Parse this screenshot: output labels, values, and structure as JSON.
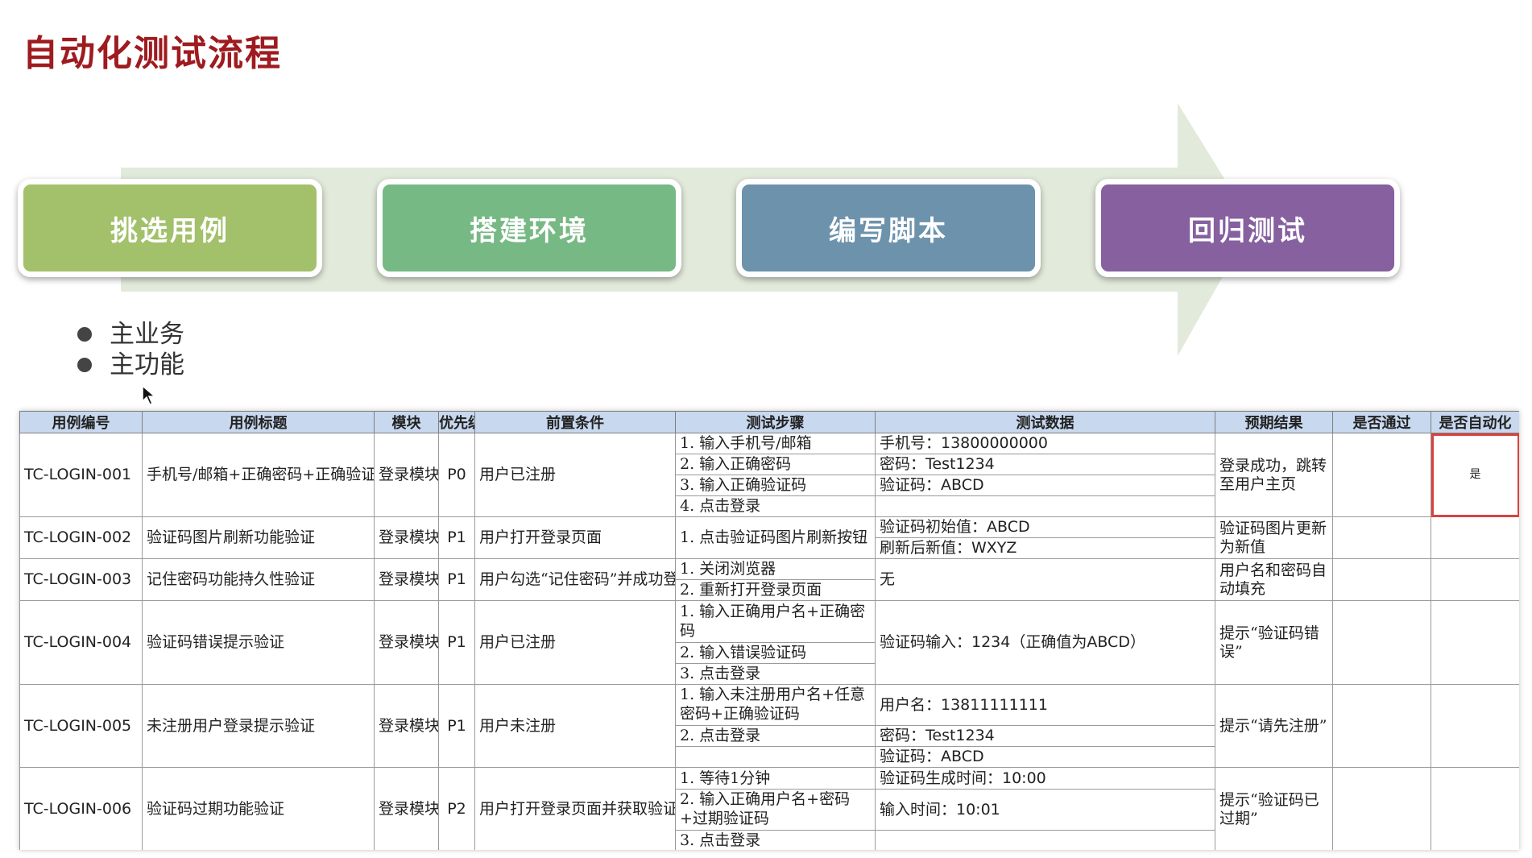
{
  "page": {
    "title": "自动化测试流程"
  },
  "flow": {
    "steps": [
      {
        "label": "挑选用例",
        "color": "#a3c06b"
      },
      {
        "label": "搭建环境",
        "color": "#77b984"
      },
      {
        "label": "编写脚本",
        "color": "#6d92ac"
      },
      {
        "label": "回归测试",
        "color": "#86609f"
      }
    ],
    "arrow_color": "#e2eadb"
  },
  "bullets": [
    "主业务",
    "主功能"
  ],
  "table": {
    "headers": [
      "用例编号",
      "用例标题",
      "模块",
      "优先级",
      "前置条件",
      "测试步骤",
      "测试数据",
      "预期结果",
      "是否通过",
      "是否自动化"
    ],
    "rows": [
      {
        "id": "TC-LOGIN-001",
        "title": "手机号/邮箱+正确密码+正确验证码",
        "module": "登录模块",
        "priority": "P0",
        "precondition": "用户已注册",
        "steps": [
          "1. 输入手机号/邮箱",
          "2. 输入正确密码",
          "3. 输入正确验证码",
          "4. 点击登录"
        ],
        "data": [
          "手机号：13800000000",
          "密码：Test1234",
          "验证码：ABCD",
          ""
        ],
        "expected": "登录成功，跳转至用户主页",
        "passed": "",
        "automated": "是"
      },
      {
        "id": "TC-LOGIN-002",
        "title": "验证码图片刷新功能验证",
        "module": "登录模块",
        "priority": "P1",
        "precondition": "用户打开登录页面",
        "steps": [
          "1. 点击验证码图片刷新按钮"
        ],
        "data": [
          "验证码初始值：ABCD",
          "刷新后新值：WXYZ"
        ],
        "expected": "验证码图片更新为新值",
        "passed": "",
        "automated": ""
      },
      {
        "id": "TC-LOGIN-003",
        "title": "记住密码功能持久性验证",
        "module": "登录模块",
        "priority": "P1",
        "precondition": "用户勾选“记住密码”并成功登录",
        "steps": [
          "1. 关闭浏览器",
          "2. 重新打开登录页面"
        ],
        "data": [
          "无"
        ],
        "expected": "用户名和密码自动填充",
        "passed": "",
        "automated": ""
      },
      {
        "id": "TC-LOGIN-004",
        "title": "验证码错误提示验证",
        "module": "登录模块",
        "priority": "P1",
        "precondition": "用户已注册",
        "steps": [
          "1. 输入正确用户名+正确密码",
          "2. 输入错误验证码",
          "3. 点击登录"
        ],
        "data": [
          "验证码输入：1234（正确值为ABCD）"
        ],
        "expected": "提示“验证码错误”",
        "passed": "",
        "automated": ""
      },
      {
        "id": "TC-LOGIN-005",
        "title": "未注册用户登录提示验证",
        "module": "登录模块",
        "priority": "P1",
        "precondition": "用户未注册",
        "steps": [
          "1. 输入未注册用户名+任意密码+正确验证码",
          "2. 点击登录",
          ""
        ],
        "data": [
          "用户名：13811111111",
          "密码：Test1234",
          "验证码：ABCD"
        ],
        "expected": "提示“请先注册”",
        "passed": "",
        "automated": ""
      },
      {
        "id": "TC-LOGIN-006",
        "title": "验证码过期功能验证",
        "module": "登录模块",
        "priority": "P2",
        "precondition": "用户打开登录页面并获取验证码",
        "steps": [
          "1. 等待1分钟",
          "2. 输入正确用户名+密码+过期验证码",
          "3. 点击登录"
        ],
        "data": [
          "验证码生成时间：10:00",
          "输入时间：10:01",
          ""
        ],
        "expected": "提示“验证码已过期”",
        "passed": "",
        "automated": ""
      }
    ]
  }
}
